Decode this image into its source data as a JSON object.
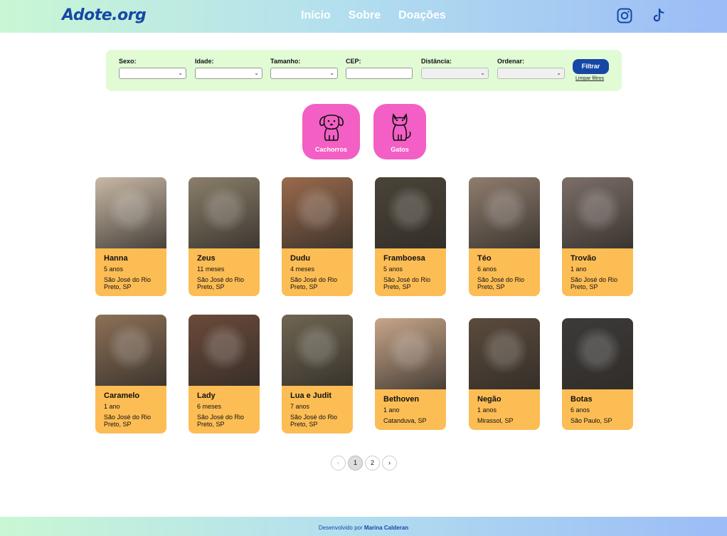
{
  "header": {
    "logo": "Adote.org",
    "nav": [
      "Início",
      "Sobre",
      "Doações"
    ],
    "social": [
      "instagram-icon",
      "tiktok-icon"
    ]
  },
  "filters": {
    "sexo_label": "Sexo:",
    "idade_label": "Idade:",
    "tamanho_label": "Tamanho:",
    "cep_label": "CEP:",
    "distancia_label": "Distância:",
    "ordenar_label": "Ordenar:",
    "filter_button": "Filtrar",
    "clear_link": "Limpar filtros"
  },
  "species": {
    "dogs_label": "Cachorros",
    "cats_label": "Gatos",
    "dogs_icon": "dog-icon",
    "cats_icon": "cat-icon"
  },
  "pets": [
    {
      "name": "Hanna",
      "age": "5 anos",
      "location": "São José do Rio Preto, SP",
      "color": "#c9b9a6"
    },
    {
      "name": "Zeus",
      "age": "11 meses",
      "location": "São José do Rio Preto, SP",
      "color": "#8a7f6a"
    },
    {
      "name": "Dudu",
      "age": "4 meses",
      "location": "São José do Rio Preto, SP",
      "color": "#9a6a4c"
    },
    {
      "name": "Framboesa",
      "age": "5 anos",
      "location": "São José do Rio Preto, SP",
      "color": "#4b4438"
    },
    {
      "name": "Téo",
      "age": "6 anos",
      "location": "São José do Rio Preto, SP",
      "color": "#8f7d6e"
    },
    {
      "name": "Trovão",
      "age": "1 ano",
      "location": "São José do Rio Preto, SP",
      "color": "#7c6f68"
    },
    {
      "name": "Caramelo",
      "age": "1 ano",
      "location": "São José do Rio Preto, SP",
      "color": "#8d7158"
    },
    {
      "name": "Lady",
      "age": "6 meses",
      "location": "São José do Rio Preto, SP",
      "color": "#6b4a3a"
    },
    {
      "name": "Lua e Judit",
      "age": "7 anos",
      "location": "São José do Rio Preto, SP",
      "color": "#6f6652"
    },
    {
      "name": "Bethoven",
      "age": "1 ano",
      "location": "Catanduva, SP",
      "color": "#c8a68a"
    },
    {
      "name": "Negão",
      "age": "1 anos",
      "location": "Mirassol, SP",
      "color": "#5b4b3c"
    },
    {
      "name": "Botas",
      "age": "6 anos",
      "location": "São Paulo, SP",
      "color": "#3c3a3a"
    }
  ],
  "pagination": {
    "prev": "‹",
    "pages": [
      "1",
      "2"
    ],
    "next": "›",
    "current": "1"
  },
  "footer": {
    "text": "Desenvolvido por ",
    "author": "Marina Calderan"
  }
}
